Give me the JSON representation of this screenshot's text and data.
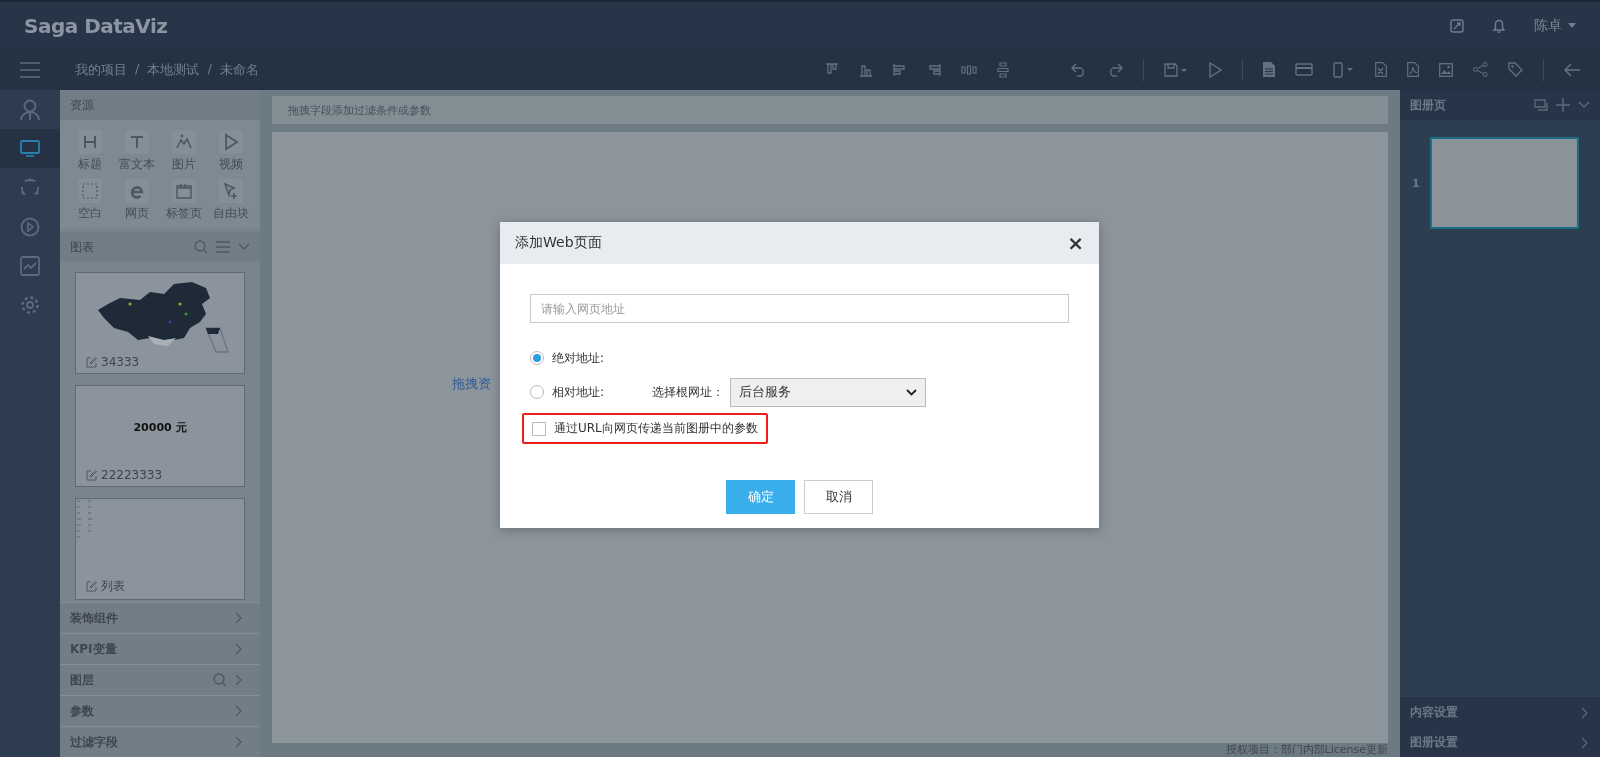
{
  "header": {
    "logo": "Saga DataViz",
    "user": "陈卓"
  },
  "breadcrumb": {
    "items": [
      "我的项目",
      "本地测试",
      "未命名"
    ],
    "separator": "/"
  },
  "rail": [
    {
      "selected": false
    },
    {
      "selected": true
    },
    {
      "selected": false
    },
    {
      "selected": false
    },
    {
      "selected": false
    },
    {
      "selected": false
    }
  ],
  "resources": {
    "title": "资源",
    "items": [
      "标题",
      "富文本",
      "图片",
      "视频",
      "空白",
      "网页",
      "标签页",
      "自由块"
    ]
  },
  "charts": {
    "title": "图表",
    "cards": [
      {
        "kind": "map",
        "name": "34333"
      },
      {
        "kind": "kpi",
        "name": "22223333",
        "value": "20000 元"
      },
      {
        "kind": "table",
        "name": "列表"
      }
    ]
  },
  "sections": [
    {
      "label": "装饰组件",
      "search": false
    },
    {
      "label": "KPI变量",
      "search": false
    },
    {
      "label": "图层",
      "search": true
    },
    {
      "label": "参数",
      "search": false
    },
    {
      "label": "过滤字段",
      "search": false
    }
  ],
  "filter_bar": {
    "placeholder": "拖拽字段添加过滤条件或参数"
  },
  "canvas": {
    "hint": "拖拽资",
    "footer": "授权项目：部门内部License更新"
  },
  "pages_panel": {
    "title": "图册页",
    "pages": [
      {
        "number": "1",
        "selected": true
      }
    ],
    "settings": [
      "内容设置",
      "图册设置"
    ]
  },
  "dialog": {
    "title": "添加Web页面",
    "close": "×",
    "url": {
      "placeholder": "请输入网页地址"
    },
    "options": [
      {
        "label": "绝对地址:",
        "selected": true
      },
      {
        "label": "相对地址:",
        "selected": false
      }
    ],
    "root_label": "选择根网址：",
    "root_value": "后台服务",
    "pass_params": {
      "label": "通过URL向网页传递当前图册中的参数",
      "checked": false,
      "highlighted": true
    },
    "buttons": [
      {
        "label": "确定",
        "kind": "primary"
      },
      {
        "label": "取消",
        "kind": "default"
      }
    ]
  }
}
